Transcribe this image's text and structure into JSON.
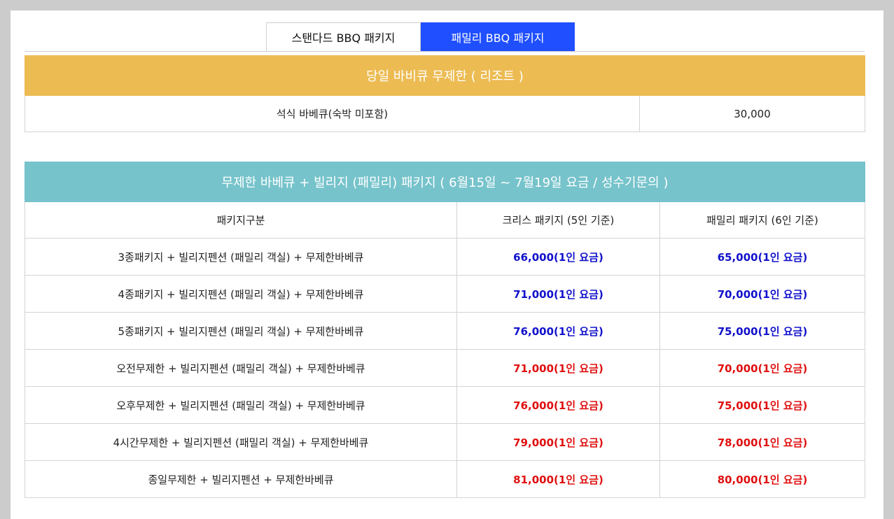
{
  "tabs": [
    {
      "label": "스탠다드 BBQ 패키지"
    },
    {
      "label": "패밀리 BBQ 패키지"
    }
  ],
  "resort_table": {
    "title": "당일 바비큐 무제한 ( 리조트 )",
    "row": {
      "label": "석식 바베큐(숙박 미포함)",
      "price": "30,000"
    }
  },
  "package_table": {
    "title": "무제한 바베큐 + 빌리지 (패밀리) 패키지 ( 6월15일 ~ 7월19일 요금 / 성수기문의 )",
    "columns": [
      "패키지구분",
      "크리스 패키지 (5인 기준)",
      "패밀리 패키지 (6인 기준)"
    ],
    "rows": [
      {
        "name": "3종패키지 + 빌리지펜션 (패밀리 객실) + 무제한바베큐",
        "kris": "66,000(1인 요금)",
        "family": "65,000(1인 요금)"
      },
      {
        "name": "4종패키지 + 빌리지펜션 (패밀리 객실) + 무제한바베큐",
        "kris": "71,000(1인 요금)",
        "family": "70,000(1인 요금)"
      },
      {
        "name": "5종패키지 + 빌리지펜션 (패밀리 객실) + 무제한바베큐",
        "kris": "76,000(1인 요금)",
        "family": "75,000(1인 요금)"
      },
      {
        "name": "오전무제한 + 빌리지펜션 (패밀리 객실) + 무제한바베큐",
        "kris": "71,000(1인 요금)",
        "family": "70,000(1인 요금)"
      },
      {
        "name": "오후무제한 + 빌리지펜션 (패밀리 객실) + 무제한바베큐",
        "kris": "76,000(1인 요금)",
        "family": "75,000(1인 요금)"
      },
      {
        "name": "4시간무제한 + 빌리지펜션 (패밀리 객실) + 무제한바베큐",
        "kris": "79,000(1인 요금)",
        "family": "78,000(1인 요금)"
      },
      {
        "name": "종일무제한 + 빌리지펜션 + 무제한바베큐",
        "kris": "81,000(1인 요금)",
        "family": "80,000(1인 요금)"
      }
    ]
  },
  "colors": {
    "active_tab": "#1f4fff",
    "resort_header": "#ecbb52",
    "package_header": "#76c3cb",
    "price_blue": "#1111cc",
    "price_red": "#e01010"
  }
}
